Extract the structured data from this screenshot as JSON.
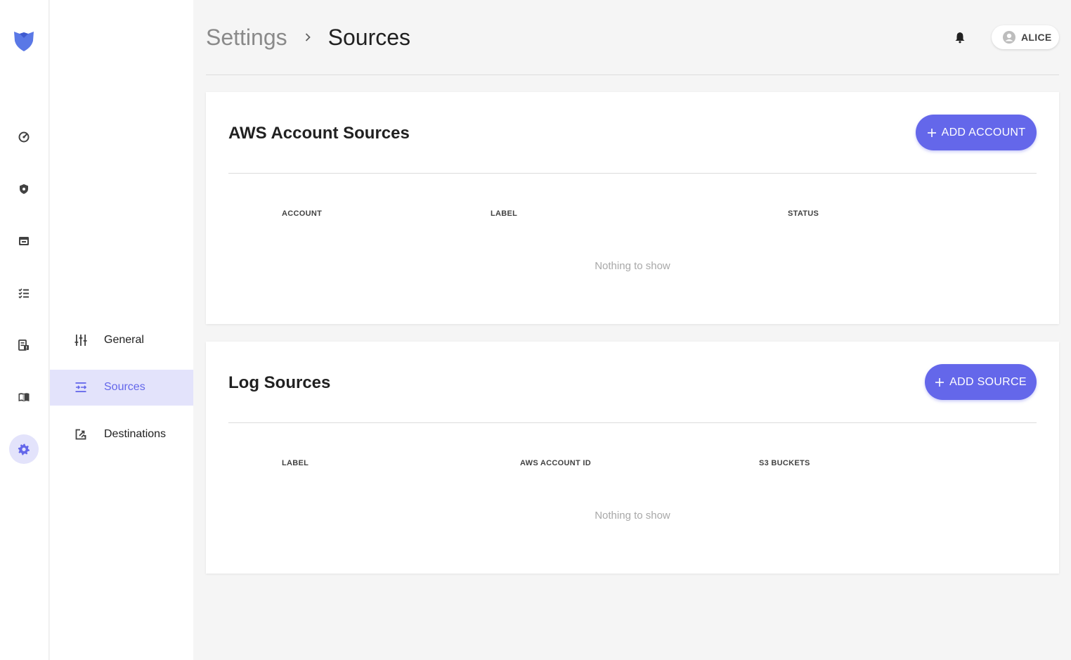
{
  "colors": {
    "accent": "#6467ea",
    "accent_light": "#e3e3fb",
    "background": "#f5f5f5"
  },
  "rail": {
    "items": [
      {
        "name": "dashboard-icon"
      },
      {
        "name": "shield-icon"
      },
      {
        "name": "cloud-resources-icon"
      },
      {
        "name": "checklist-icon"
      },
      {
        "name": "alerts-log-icon"
      },
      {
        "name": "book-icon"
      },
      {
        "name": "gear-icon",
        "active": true
      }
    ]
  },
  "settings_nav": {
    "items": [
      {
        "label": "General",
        "icon": "sliders-icon"
      },
      {
        "label": "Sources",
        "icon": "sources-icon",
        "active": true
      },
      {
        "label": "Destinations",
        "icon": "destinations-icon"
      }
    ]
  },
  "header": {
    "breadcrumb_parent": "Settings",
    "breadcrumb_current": "Sources",
    "user_name": "ALICE"
  },
  "aws_sources": {
    "title": "AWS Account Sources",
    "add_label": "ADD ACCOUNT",
    "columns": [
      "ACCOUNT",
      "LABEL",
      "STATUS"
    ],
    "empty_text": "Nothing to show"
  },
  "log_sources": {
    "title": "Log Sources",
    "add_label": "ADD SOURCE",
    "columns": [
      "LABEL",
      "AWS ACCOUNT ID",
      "S3 BUCKETS"
    ],
    "empty_text": "Nothing to show"
  }
}
